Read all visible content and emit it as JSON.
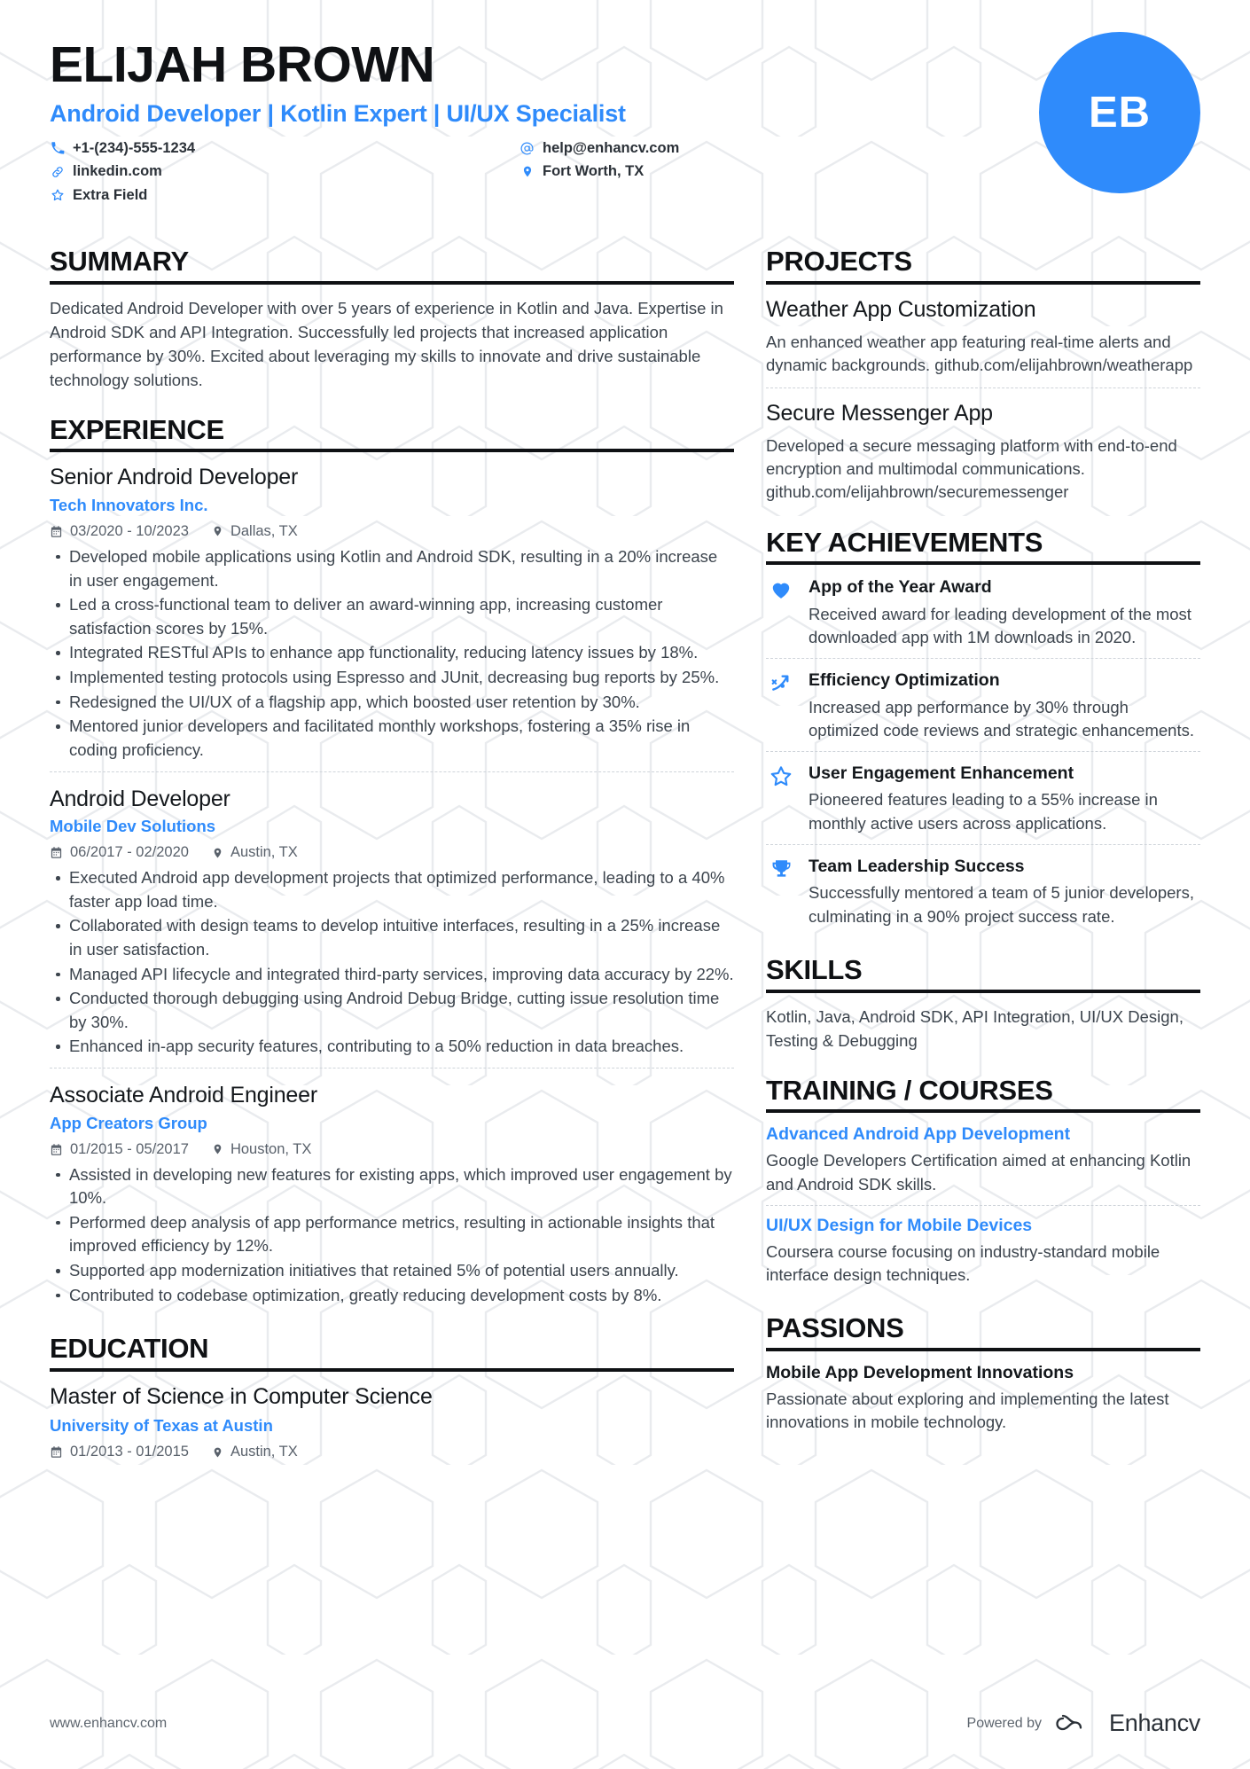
{
  "header": {
    "name": "ELIJAH BROWN",
    "headline": "Android Developer | Kotlin Expert | UI/UX Specialist",
    "avatar_initials": "EB",
    "accent_color": "#2f8bfb",
    "contacts": [
      {
        "icon": "phone-icon",
        "value": "+1-(234)-555-1234"
      },
      {
        "icon": "at-icon",
        "value": "help@enhancv.com"
      },
      {
        "icon": "link-icon",
        "value": "linkedin.com"
      },
      {
        "icon": "location-icon",
        "value": "Fort Worth, TX"
      },
      {
        "icon": "star-icon",
        "value": "Extra Field"
      }
    ]
  },
  "summary": {
    "title": "SUMMARY",
    "text": "Dedicated Android Developer with over 5 years of experience in Kotlin and Java. Expertise in Android SDK and API Integration. Successfully led projects that increased application performance by 30%. Excited about leveraging my skills to innovate and drive sustainable technology solutions."
  },
  "experience": {
    "title": "EXPERIENCE",
    "jobs": [
      {
        "role": "Senior Android Developer",
        "company": "Tech Innovators Inc.",
        "dates": "03/2020 - 10/2023",
        "location": "Dallas, TX",
        "bullets": [
          "Developed mobile applications using Kotlin and Android SDK, resulting in a 20% increase in user engagement.",
          "Led a cross-functional team to deliver an award-winning app, increasing customer satisfaction scores by 15%.",
          "Integrated RESTful APIs to enhance app functionality, reducing latency issues by 18%.",
          "Implemented testing protocols using Espresso and JUnit, decreasing bug reports by 25%.",
          "Redesigned the UI/UX of a flagship app, which boosted user retention by 30%.",
          "Mentored junior developers and facilitated monthly workshops, fostering a 35% rise in coding proficiency."
        ]
      },
      {
        "role": "Android Developer",
        "company": "Mobile Dev Solutions",
        "dates": "06/2017 - 02/2020",
        "location": "Austin, TX",
        "bullets": [
          "Executed Android app development projects that optimized performance, leading to a 40% faster app load time.",
          "Collaborated with design teams to develop intuitive interfaces, resulting in a 25% increase in user satisfaction.",
          "Managed API lifecycle and integrated third-party services, improving data accuracy by 22%.",
          "Conducted thorough debugging using Android Debug Bridge, cutting issue resolution time by 30%.",
          "Enhanced in-app security features, contributing to a 50% reduction in data breaches."
        ]
      },
      {
        "role": "Associate Android Engineer",
        "company": "App Creators Group",
        "dates": "01/2015 - 05/2017",
        "location": "Houston, TX",
        "bullets": [
          "Assisted in developing new features for existing apps, which improved user engagement by 10%.",
          "Performed deep analysis of app performance metrics, resulting in actionable insights that improved efficiency by 12%.",
          "Supported app modernization initiatives that retained 5% of potential users annually.",
          "Contributed to codebase optimization, greatly reducing development costs by 8%."
        ]
      }
    ]
  },
  "education": {
    "title": "EDUCATION",
    "entries": [
      {
        "degree": "Master of Science in Computer Science",
        "school": "University of Texas at Austin",
        "dates": "01/2013 - 01/2015",
        "location": "Austin, TX"
      }
    ]
  },
  "projects": {
    "title": "PROJECTS",
    "items": [
      {
        "name": "Weather App Customization",
        "description": "An enhanced weather app featuring real-time alerts and dynamic backgrounds. github.com/elijahbrown/weatherapp"
      },
      {
        "name": "Secure Messenger App",
        "description": "Developed a secure messaging platform with end-to-end encryption and multimodal communications. github.com/elijahbrown/securemessenger"
      }
    ]
  },
  "achievements": {
    "title": "KEY ACHIEVEMENTS",
    "items": [
      {
        "icon": "heart-icon",
        "name": "App of the Year Award",
        "description": "Received award for leading development of the most downloaded app with 1M downloads in 2020."
      },
      {
        "icon": "trend-arrow-icon",
        "name": "Efficiency Optimization",
        "description": "Increased app performance by 30% through optimized code reviews and strategic enhancements."
      },
      {
        "icon": "star-outline-icon",
        "name": "User Engagement Enhancement",
        "description": "Pioneered features leading to a 55% increase in monthly active users across applications."
      },
      {
        "icon": "trophy-icon",
        "name": "Team Leadership Success",
        "description": "Successfully mentored a team of 5 junior developers, culminating in a 90% project success rate."
      }
    ]
  },
  "skills": {
    "title": "SKILLS",
    "text": "Kotlin, Java, Android SDK, API Integration, UI/UX Design, Testing & Debugging"
  },
  "training": {
    "title": "TRAINING / COURSES",
    "items": [
      {
        "name": "Advanced Android App Development",
        "description": "Google Developers Certification aimed at enhancing Kotlin and Android SDK skills."
      },
      {
        "name": "UI/UX Design for Mobile Devices",
        "description": "Coursera course focusing on industry-standard mobile interface design techniques."
      }
    ]
  },
  "passions": {
    "title": "PASSIONS",
    "items": [
      {
        "name": "Mobile App Development Innovations",
        "description": "Passionate about exploring and implementing the latest innovations in mobile technology."
      }
    ]
  },
  "footer": {
    "url": "www.enhancv.com",
    "powered_by": "Powered by",
    "brand": "Enhancv"
  }
}
